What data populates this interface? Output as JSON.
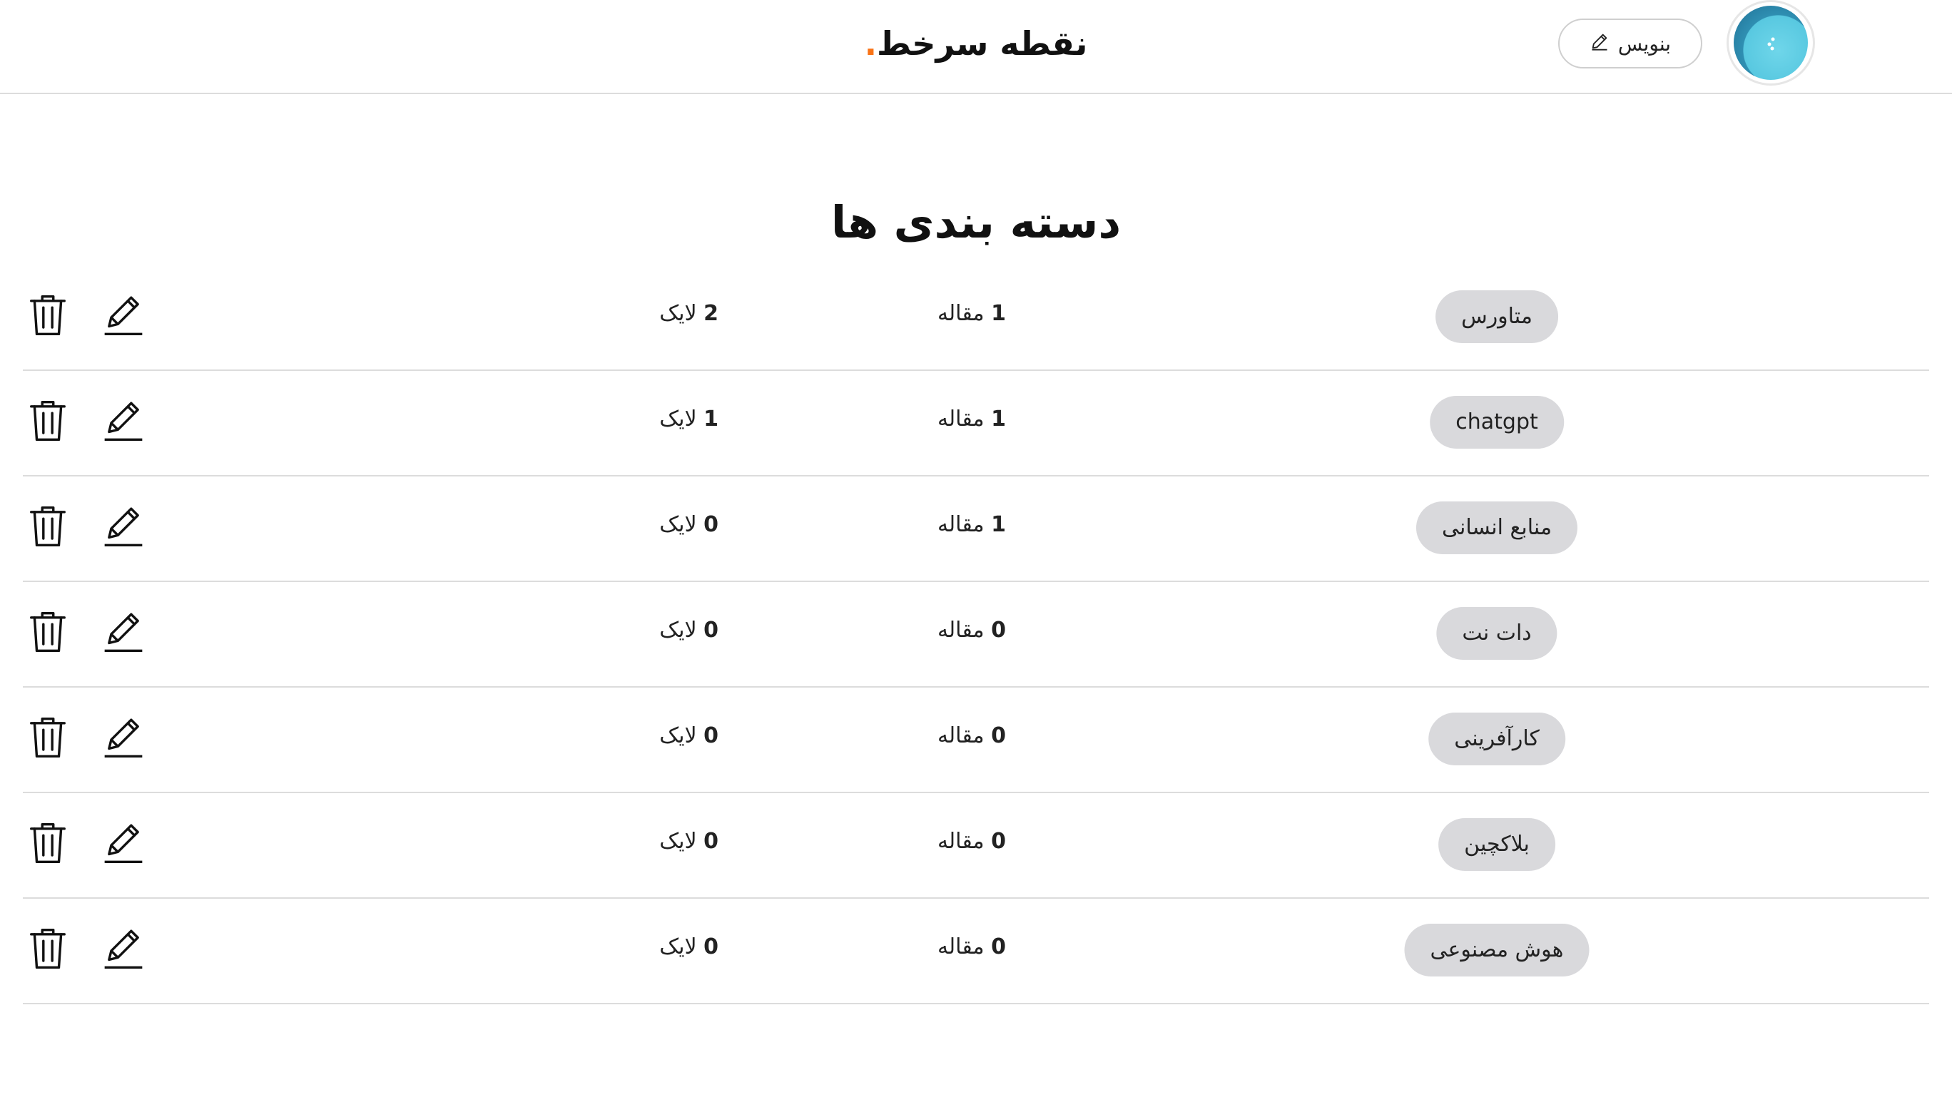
{
  "header": {
    "brand_text": "نقطه سرخط",
    "brand_dot": ".",
    "brand_dot_color": "#f97316",
    "write_label": "بنویس",
    "write_icon": "pencil-icon",
    "avatar_icon": "user-avatar"
  },
  "page": {
    "title": "دسته بندی ها"
  },
  "categories": [
    {
      "name": "متاورس",
      "articles": "1",
      "likes": "2"
    },
    {
      "name": "chatgpt",
      "articles": "1",
      "likes": "1"
    },
    {
      "name": "منابع انسانی",
      "articles": "1",
      "likes": "0"
    },
    {
      "name": "دات نت",
      "articles": "0",
      "likes": "0"
    },
    {
      "name": "کارآفرینی",
      "articles": "0",
      "likes": "0"
    },
    {
      "name": "بلاکچین",
      "articles": "0",
      "likes": "0"
    },
    {
      "name": "هوش مصنوعی",
      "articles": "0",
      "likes": "0"
    }
  ],
  "labels": {
    "articles_unit": "مقاله",
    "likes_unit": "لایک"
  },
  "icons": {
    "edit": "edit-icon",
    "delete": "trash-icon"
  }
}
